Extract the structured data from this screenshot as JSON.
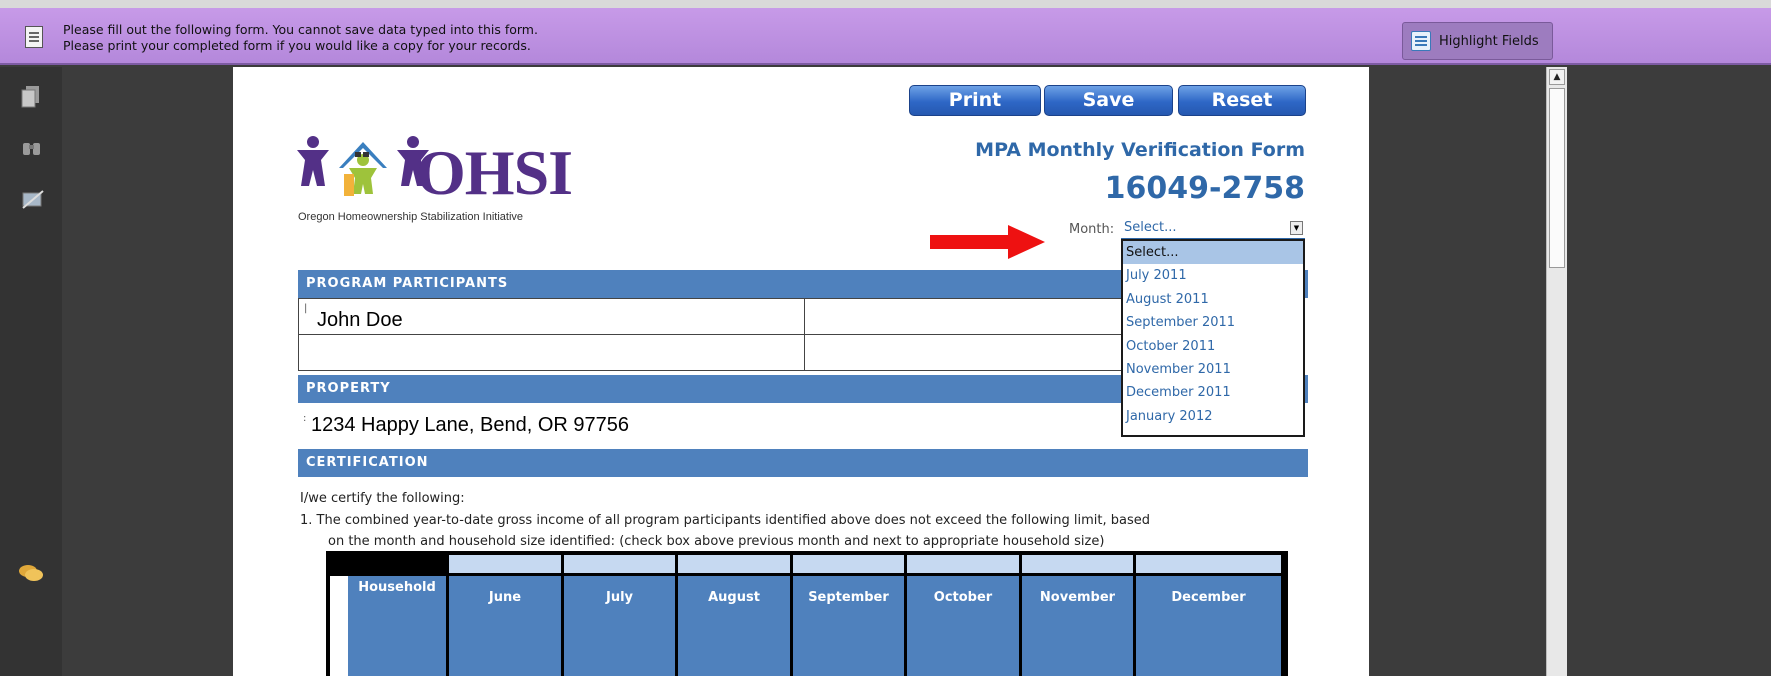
{
  "notice": {
    "line1": "Please fill out the following form. You cannot save data typed into this form.",
    "line2": "Please print your completed form if you would like a copy for your records.",
    "highlight_label": "Highlight Fields"
  },
  "buttons": {
    "print": "Print",
    "save": "Save",
    "reset": "Reset"
  },
  "logo": {
    "name": "OHSI",
    "tagline": "Oregon Homeownership Stabilization Initiative"
  },
  "form": {
    "title": "MPA Monthly Verification Form",
    "number": "16049-2758",
    "month_label": "Month:",
    "month_value": "Select..."
  },
  "month_options": [
    "Select...",
    "July 2011",
    "August 2011",
    "September 2011",
    "October 2011",
    "November 2011",
    "December 2011",
    "January 2012"
  ],
  "sections": {
    "participants": "PROGRAM PARTICIPANTS",
    "property": "PROPERTY",
    "certification": "CERTIFICATION"
  },
  "participants": {
    "name1": "John Doe",
    "name2": ""
  },
  "property": {
    "address": "1234 Happy Lane, Bend, OR 97756"
  },
  "certification": {
    "intro": "I/we certify the following:",
    "item1_line1": "1.  The combined year-to-date gross income of all program participants identified above does not exceed the following limit, based",
    "item1_line2": "on the month and household size identified: (check box above previous month and next to appropriate household size)"
  },
  "table": {
    "first_header": "Household",
    "months": [
      "June",
      "July",
      "August",
      "September",
      "October",
      "November",
      "December"
    ]
  },
  "colors": {
    "accent": "#4f81bd",
    "title": "#2f68a8",
    "notice_bar": "#c79ae8",
    "logo_purple": "#533087"
  }
}
